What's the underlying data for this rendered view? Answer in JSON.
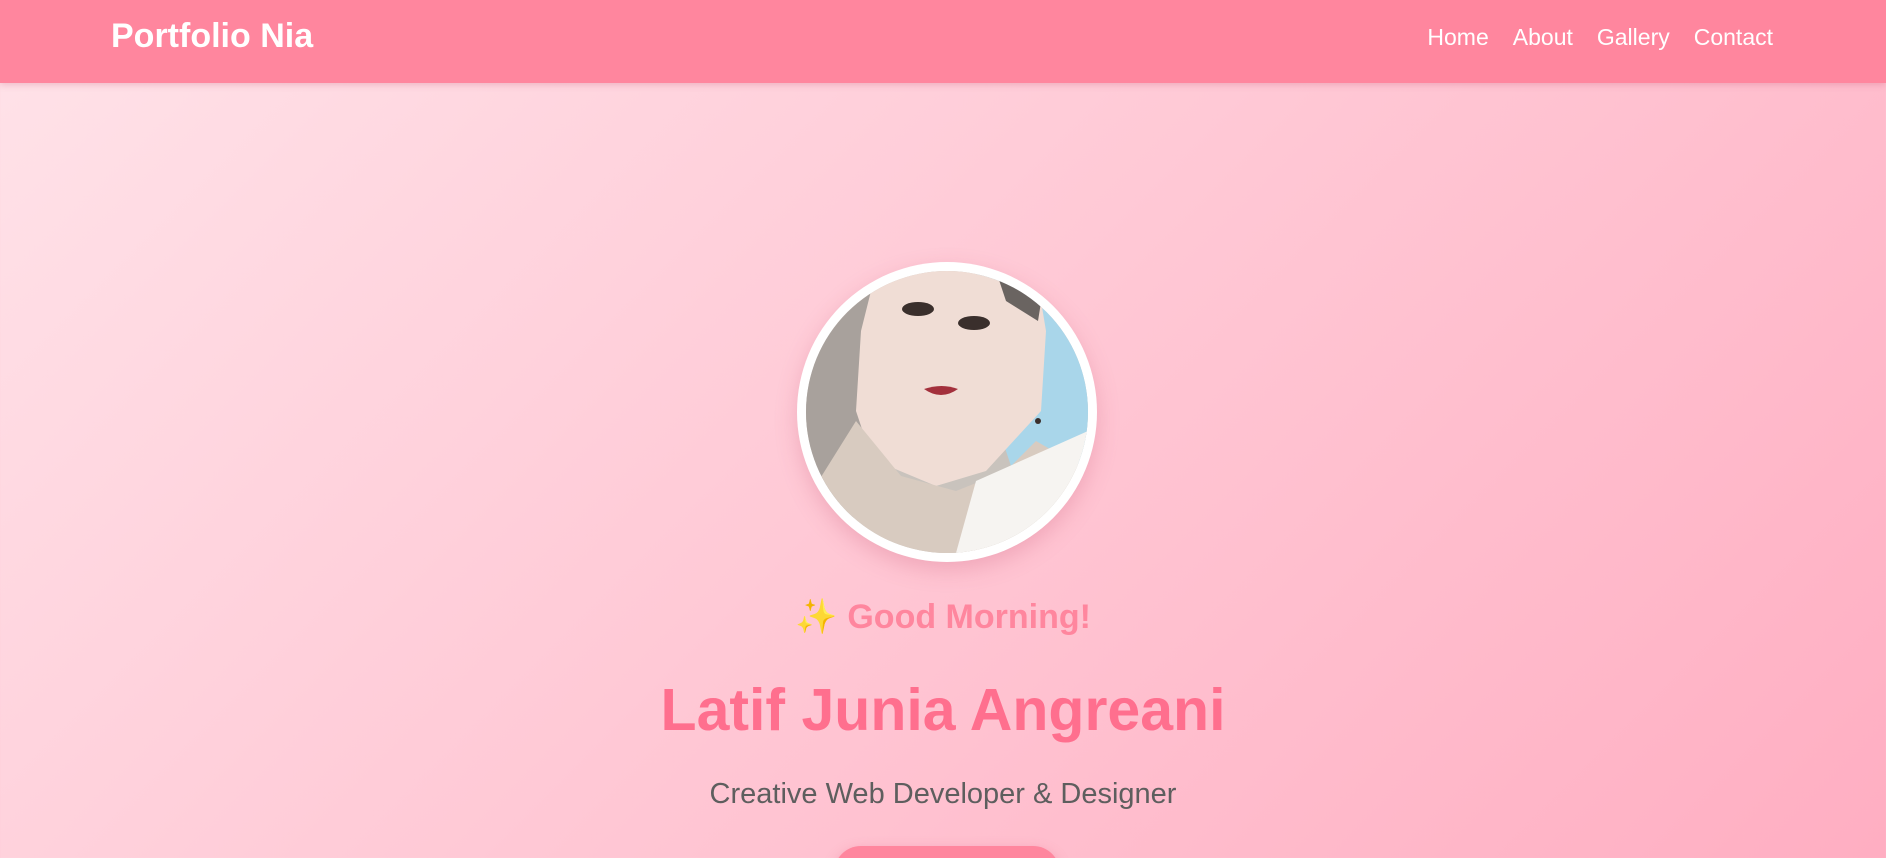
{
  "navbar": {
    "brand": "Portfolio Nia",
    "links": [
      "Home",
      "About",
      "Gallery",
      "Contact"
    ]
  },
  "hero": {
    "greeting_icon": "sparkles-icon",
    "greeting_icon_glyph": "✨",
    "greeting": "Good Morning!",
    "name": "Latif Junia Angreani",
    "role": "Creative Web Developer & Designer"
  },
  "colors": {
    "nav_bg": "#ff869e",
    "name": "#ff6f8e",
    "greeting": "#ff869e",
    "role": "#5e5e5e",
    "background_start": "#ffe3e9",
    "background_end": "#ffaec2"
  }
}
